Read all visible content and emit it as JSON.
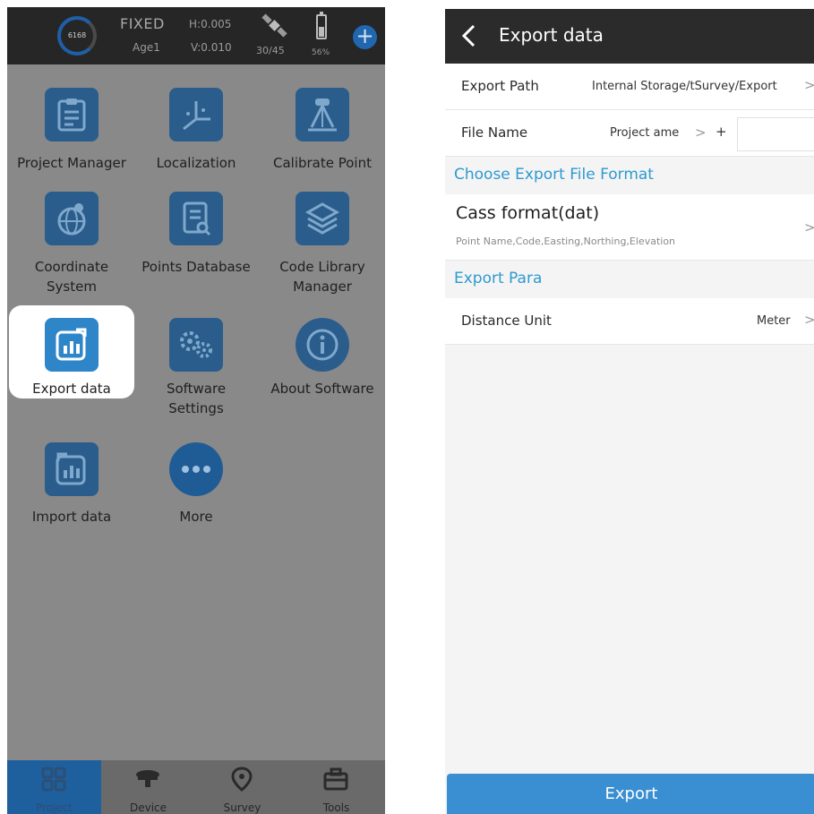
{
  "left_screen": {
    "status_bar": {
      "ring_value": "6168",
      "fix_status": "FIXED",
      "age": "Age1",
      "h_precision": "H:0.005",
      "v_precision": "V:0.010",
      "satellites": "30/45",
      "battery": "56%"
    },
    "grid": [
      {
        "label": "Project Manager",
        "icon": "clipboard-icon"
      },
      {
        "label": "Localization",
        "icon": "axes-icon"
      },
      {
        "label": "Calibrate Point",
        "icon": "tripod-icon"
      },
      {
        "label": "Coordinate System",
        "icon": "globe-icon"
      },
      {
        "label": "Points Database",
        "icon": "document-search-icon"
      },
      {
        "label": "Code Library Manager",
        "icon": "layers-icon"
      },
      {
        "label": "Export data",
        "icon": "export-chart-icon"
      },
      {
        "label": "Software Settings",
        "icon": "gears-icon"
      },
      {
        "label": "About Software",
        "icon": "info-icon"
      },
      {
        "label": "Import data",
        "icon": "import-chart-icon"
      },
      {
        "label": "More",
        "icon": "more-dots-icon"
      }
    ],
    "bottom_nav": [
      {
        "label": "Project",
        "icon": "grid-icon",
        "active": true
      },
      {
        "label": "Device",
        "icon": "receiver-icon",
        "active": false
      },
      {
        "label": "Survey",
        "icon": "location-pin-icon",
        "active": false
      },
      {
        "label": "Tools",
        "icon": "toolbox-icon",
        "active": false
      }
    ]
  },
  "right_screen": {
    "title": "Export data",
    "export_path": {
      "label": "Export Path",
      "value": "Internal Storage/tSurvey/Export"
    },
    "file_name": {
      "label": "File Name",
      "value": "Project ame",
      "separator": ">",
      "add": "+"
    },
    "section_format": "Choose Export File Format",
    "format": {
      "title": "Cass format(dat)",
      "fields": "Point Name,Code,Easting,Northing,Elevation"
    },
    "section_para": "Export Para",
    "distance_unit": {
      "label": "Distance Unit",
      "value": "Meter"
    },
    "export_button": "Export",
    "chevron": ">"
  }
}
